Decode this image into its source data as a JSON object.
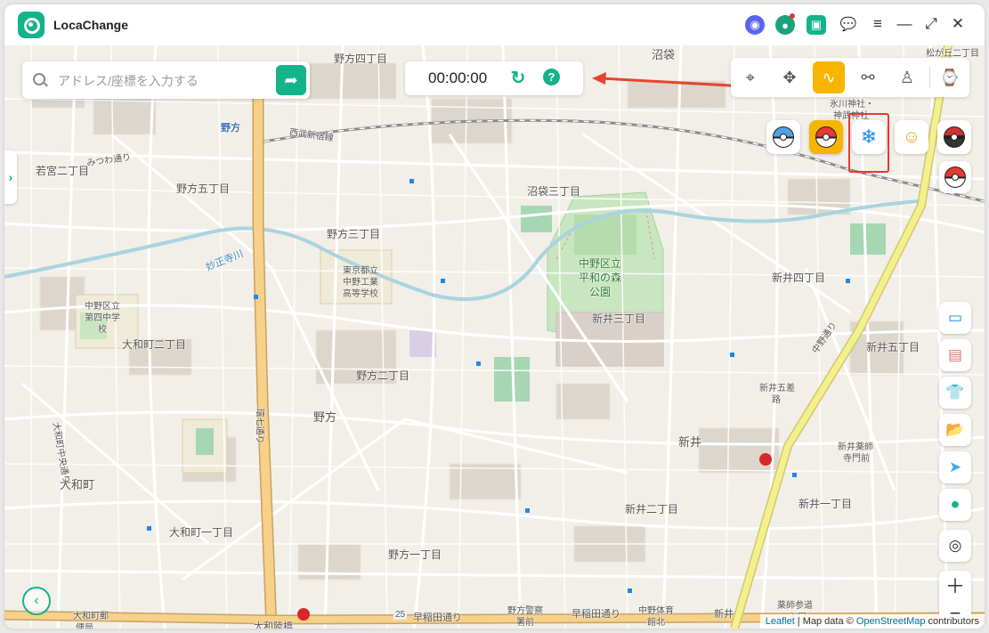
{
  "app": {
    "title": "LocaChange"
  },
  "titlebar": {
    "icons": [
      "discord-icon",
      "avatar-icon",
      "toolbox-icon",
      "chat-icon",
      "menu-icon"
    ],
    "window_controls": [
      "minimize-icon",
      "fullscreen-icon",
      "close-icon"
    ]
  },
  "search": {
    "placeholder": "アドレス/座標を入力する",
    "value": ""
  },
  "timer": {
    "value": "00:00:00"
  },
  "modes": [
    "teleport-mode",
    "joystick-mode",
    "two-spot-mode",
    "multi-spot-mode",
    "jump-mode",
    "history"
  ],
  "active_mode": "two-spot-mode",
  "games": [
    "pokemon-go-map",
    "pokeball-game",
    "snowflake-game",
    "coin-game",
    "pokeball-dark",
    "pokeball-red"
  ],
  "map": {
    "labels": [
      "野方四丁目",
      "沼袋",
      "若宮二丁目",
      "野方五丁目",
      "野方三丁目",
      "沼袋三丁目",
      "東京都立",
      "中野工業",
      "高等学校",
      "中野区立",
      "平和の森",
      "公園",
      "新井四丁目",
      "新井三丁目",
      "中野区立",
      "第四中学",
      "校",
      "大和町二丁目",
      "野方二丁目",
      "新井五丁目",
      "新井五差",
      "路",
      "野方",
      "新井",
      "新井薬師",
      "寺門前",
      "大和町",
      "新井二丁目",
      "大和町一丁目",
      "新井一丁目",
      "野方一丁目",
      "大和町郵",
      "便局",
      "野方警察",
      "署前",
      "早稲田通り",
      "早稲田通り",
      "中野体育",
      "館北",
      "新井",
      "薬師参道",
      "入口",
      "大和陸橋",
      "氷川神社・",
      "神武神社",
      "妙正寺川",
      "西武新宿線",
      "みつわ通り",
      "野方",
      "大和町中央通り",
      "環七通り",
      "中野通り",
      "25",
      "松が丘二丁目"
    ]
  },
  "attribution": {
    "leaflet": "Leaflet",
    "sep": " | Map data © ",
    "osm": "OpenStreetMap",
    "suffix": " contributors"
  },
  "colors": {
    "accent": "#14b38a",
    "active_mode": "#f7b500",
    "highlight": "#e53935"
  }
}
